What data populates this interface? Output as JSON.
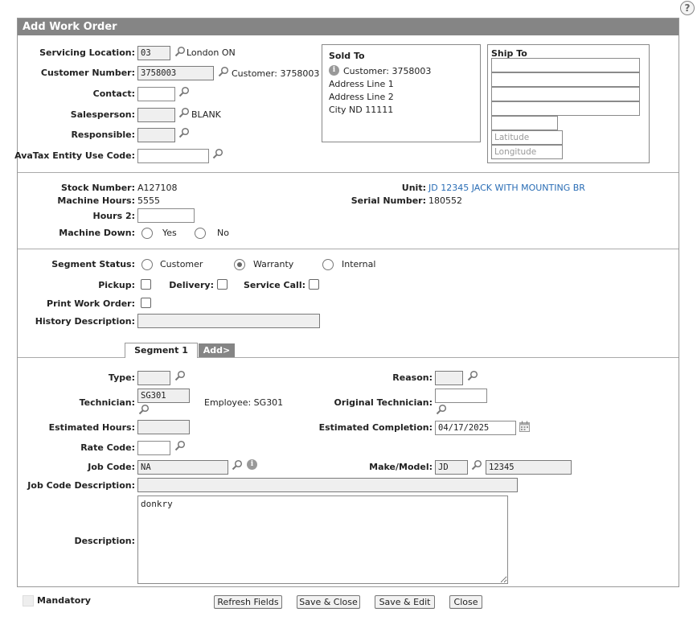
{
  "dialog": {
    "title": "Add Work Order",
    "help": "?"
  },
  "header": {
    "servicing_location_label": "Servicing Location:",
    "servicing_location_value": "03",
    "servicing_location_name": "London ON",
    "customer_number_label": "Customer Number:",
    "customer_number_value": "3758003",
    "customer_number_text": "Customer: 3758003",
    "contact_label": "Contact:",
    "contact_value": "",
    "salesperson_label": "Salesperson:",
    "salesperson_value": "",
    "salesperson_name": "BLANK",
    "responsible_label": "Responsible:",
    "responsible_value": "",
    "avatax_label": "AvaTax Entity Use Code:",
    "avatax_value": ""
  },
  "sold_to": {
    "title": "Sold To",
    "customer": "Customer: 3758003",
    "address1": "Address Line 1",
    "address2": "Address Line 2",
    "city": "City ND 11111"
  },
  "ship_to": {
    "title": "Ship To",
    "latitude_placeholder": "Latitude",
    "longitude_placeholder": "Longitude"
  },
  "unit_section": {
    "stock_number_label": "Stock Number:",
    "stock_number_value": "A127108",
    "machine_hours_label": "Machine Hours:",
    "machine_hours_value": "5555",
    "hours2_label": "Hours 2:",
    "hours2_value": "",
    "machine_down_label": "Machine Down:",
    "machine_down_yes": "Yes",
    "machine_down_no": "No",
    "unit_label": "Unit:",
    "unit_value": "JD 12345 JACK WITH MOUNTING BR",
    "serial_label": "Serial Number:",
    "serial_value": "180552"
  },
  "segment_section": {
    "status_label": "Segment Status:",
    "status_options": [
      "Customer",
      "Warranty",
      "Internal"
    ],
    "status_selected": "Warranty",
    "pickup_label": "Pickup:",
    "delivery_label": "Delivery:",
    "service_call_label": "Service Call:",
    "print_wo_label": "Print Work Order:",
    "history_label": "History Description:",
    "history_value": ""
  },
  "tabs": {
    "segment1": "Segment 1",
    "add": "Add>"
  },
  "segment": {
    "type_label": "Type:",
    "type_value": "",
    "reason_label": "Reason:",
    "reason_value": "",
    "technician_label": "Technician:",
    "technician_value": "SG301",
    "technician_employee": "Employee: SG301",
    "orig_tech_label": "Original Technician:",
    "orig_tech_value": "",
    "est_hours_label": "Estimated Hours:",
    "est_hours_value": "",
    "est_completion_label": "Estimated Completion:",
    "est_completion_value": "04/17/2025",
    "rate_code_label": "Rate Code:",
    "rate_code_value": "",
    "job_code_label": "Job Code:",
    "job_code_value": "NA",
    "make_model_label": "Make/Model:",
    "make_value": "JD",
    "model_value": "12345",
    "job_desc_label": "Job Code Description:",
    "job_desc_value": "",
    "description_label": "Description:",
    "description_value": "donkry"
  },
  "footer": {
    "mandatory_label": "Mandatory",
    "refresh_button": "Refresh Fields",
    "save_close_button": "Save & Close",
    "save_edit_button": "Save & Edit",
    "close_button": "Close"
  }
}
